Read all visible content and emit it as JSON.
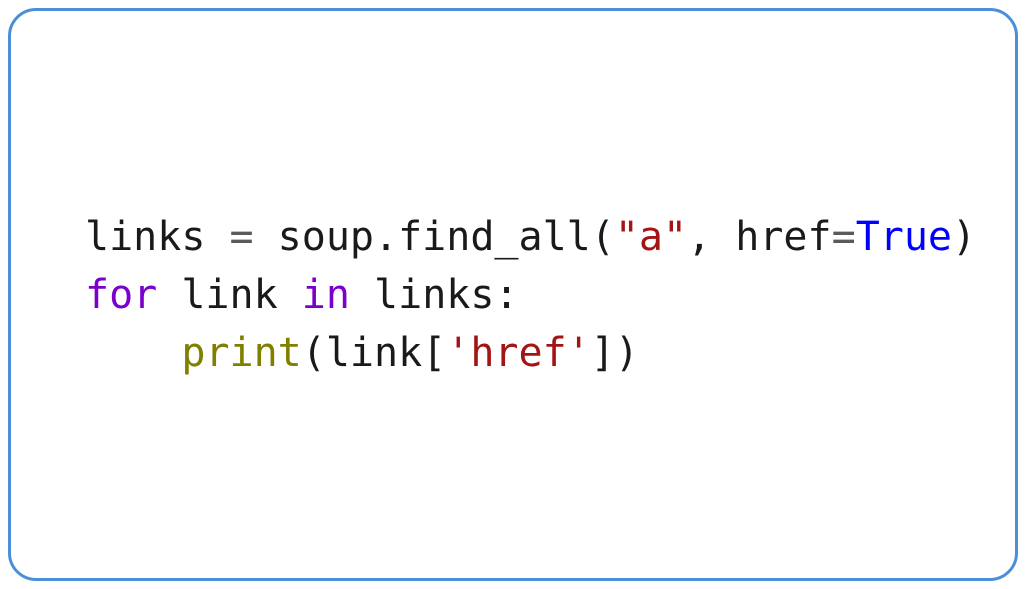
{
  "code": {
    "line1": {
      "t0": "links",
      "t1": " = ",
      "t2": "soup",
      "t3": ".",
      "t4": "find_all",
      "t5": "(",
      "t6": "\"a\"",
      "t7": ", ",
      "t8": "href",
      "t9": "=",
      "t10": "True",
      "t11": ")"
    },
    "line2": {
      "t0": "for",
      "t1": " ",
      "t2": "link",
      "t3": " ",
      "t4": "in",
      "t5": " ",
      "t6": "links",
      "t7": ":"
    },
    "line3": {
      "indent": "    ",
      "t0": "print",
      "t1": "(",
      "t2": "link",
      "t3": "[",
      "t4": "'href'",
      "t5": "]",
      "t6": ")"
    }
  }
}
